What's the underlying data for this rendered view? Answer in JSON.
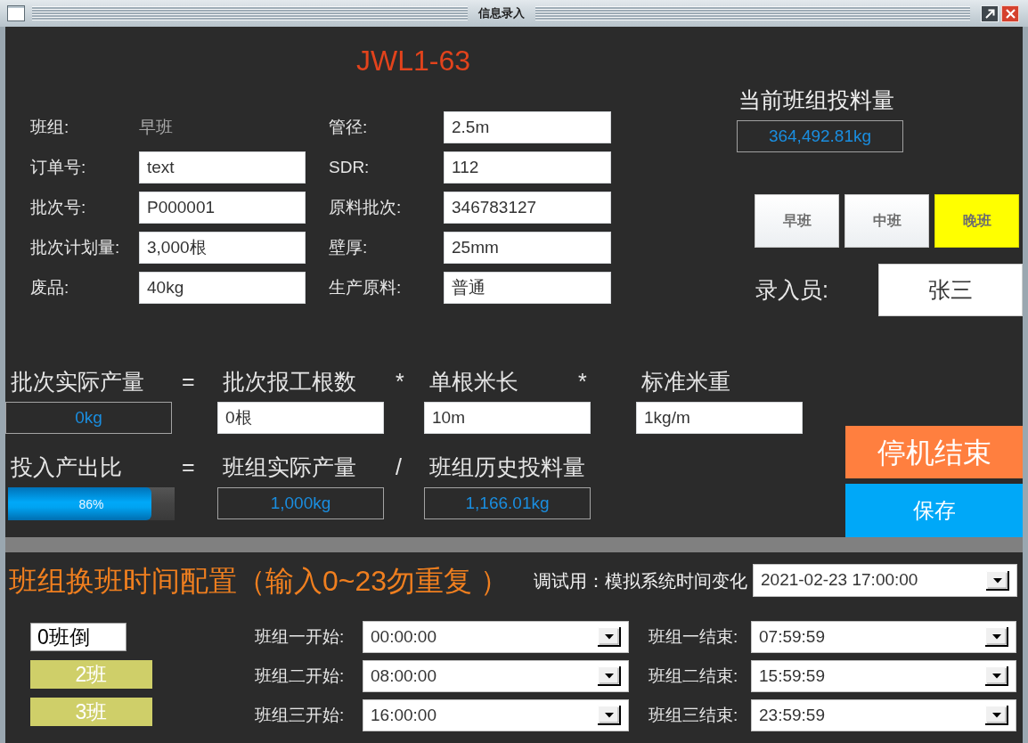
{
  "window": {
    "title": "信息录入"
  },
  "machine_code": "JWL1-63",
  "info_form": {
    "columns": [
      {
        "fields": [
          {
            "kind": "text",
            "label": "班组:",
            "value": "早班"
          },
          {
            "kind": "input",
            "label": "订单号:",
            "value": "text"
          },
          {
            "kind": "input",
            "label": "批次号:",
            "value": "P000001"
          },
          {
            "kind": "input",
            "label": "批次计划量:",
            "value": "3,000根"
          },
          {
            "kind": "input",
            "label": "废品:",
            "value": "40kg"
          }
        ]
      },
      {
        "fields": [
          {
            "kind": "input",
            "label": "管径:",
            "value": "2.5m"
          },
          {
            "kind": "input",
            "label": "SDR:",
            "value": "112"
          },
          {
            "kind": "input",
            "label": "原料批次:",
            "value": "346783127"
          },
          {
            "kind": "input",
            "label": "壁厚:",
            "value": "25mm"
          },
          {
            "kind": "input",
            "label": "生产原料:",
            "value": "普通"
          }
        ]
      }
    ]
  },
  "current_feed": {
    "label": "当前班组投料量",
    "value": "364,492.81kg"
  },
  "shift_buttons": [
    {
      "label": "早班",
      "selected": false
    },
    {
      "label": "中班",
      "selected": false
    },
    {
      "label": "晚班",
      "selected": true
    }
  ],
  "operator": {
    "label": "录入员:",
    "value": "张三"
  },
  "formulas": [
    {
      "terms": [
        {
          "kind": "readout",
          "label": "批次实际产量",
          "value": "0kg"
        },
        {
          "kind": "input",
          "label": "批次报工根数",
          "value": "0根"
        },
        {
          "kind": "input",
          "label": "单根米长",
          "value": "10m"
        },
        {
          "kind": "input",
          "label": "标准米重",
          "value": "1kg/m"
        }
      ],
      "operators": [
        "=",
        "*",
        "*"
      ]
    },
    {
      "terms": [
        {
          "kind": "progress",
          "label": "投入产出比",
          "level": 0.86,
          "reading": "86%"
        },
        {
          "kind": "readout",
          "label": "班组实际产量",
          "value": "1,000kg"
        },
        {
          "kind": "readout",
          "label": "班组历史投料量",
          "value": "1,166.01kg"
        }
      ],
      "operators": [
        "=",
        "/"
      ]
    }
  ],
  "actions": [
    {
      "kind": "stop",
      "label": "停机结束"
    },
    {
      "kind": "save",
      "label": "保存"
    }
  ],
  "shift_schedule": {
    "title": "班组换班时间配置（输入0~23勿重复 ）",
    "debug_label": "调试用：模拟系统时间变化",
    "debug_time": "2021-02-23 17:00:00",
    "shift_modes": [
      {
        "kind": "display",
        "label": "0班倒"
      },
      {
        "kind": "button",
        "label": "2班"
      },
      {
        "kind": "button",
        "label": "3班"
      }
    ],
    "rows": [
      {
        "start_label": "班组一开始:",
        "start_time": "00:00:00",
        "end_label": "班组一结束:",
        "end_time": "07:59:59"
      },
      {
        "start_label": "班组二开始:",
        "start_time": "08:00:00",
        "end_label": "班组二结束:",
        "end_time": "15:59:59"
      },
      {
        "start_label": "班组三开始:",
        "start_time": "16:00:00",
        "end_label": "班组三结束:",
        "end_time": "23:59:59"
      }
    ]
  }
}
